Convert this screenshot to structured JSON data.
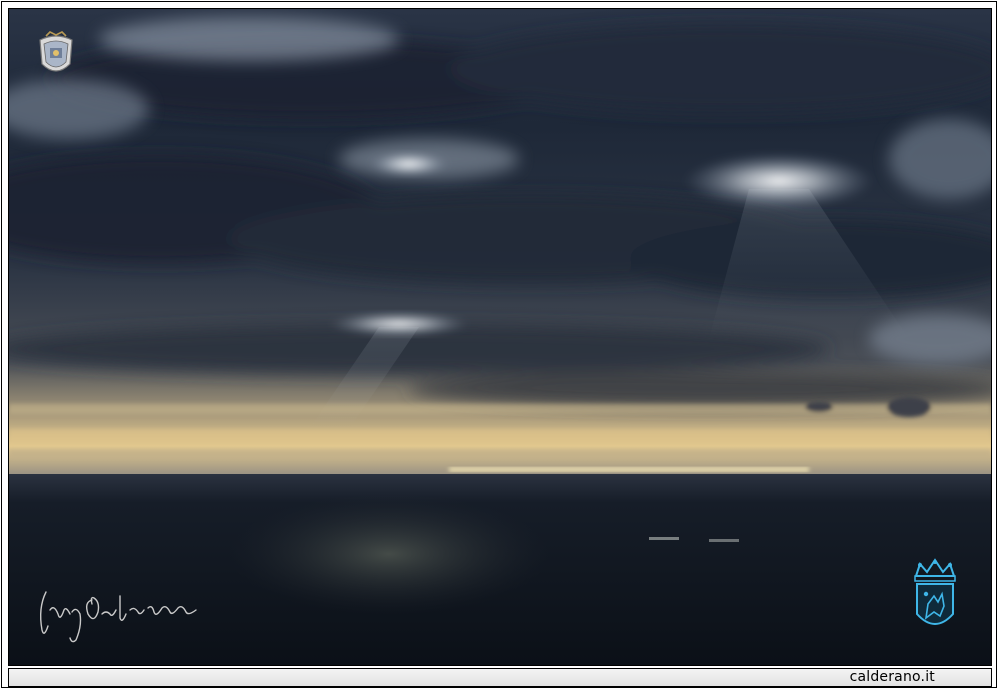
{
  "footer": {
    "site_label": "calderano.it"
  },
  "top_logo": {
    "icon": "coat-of-arms-icon"
  },
  "bottom_logo": {
    "icon": "crowned-shield-icon",
    "color": "#3fb6e8"
  },
  "signature": {
    "icon": "handwritten-signature-icon"
  },
  "scene": {
    "sky_dark": "#1f2a3a",
    "sky_mid": "#3b4658",
    "horizon_glow": "#e8c98a",
    "sea_dark": "#0e141c"
  }
}
